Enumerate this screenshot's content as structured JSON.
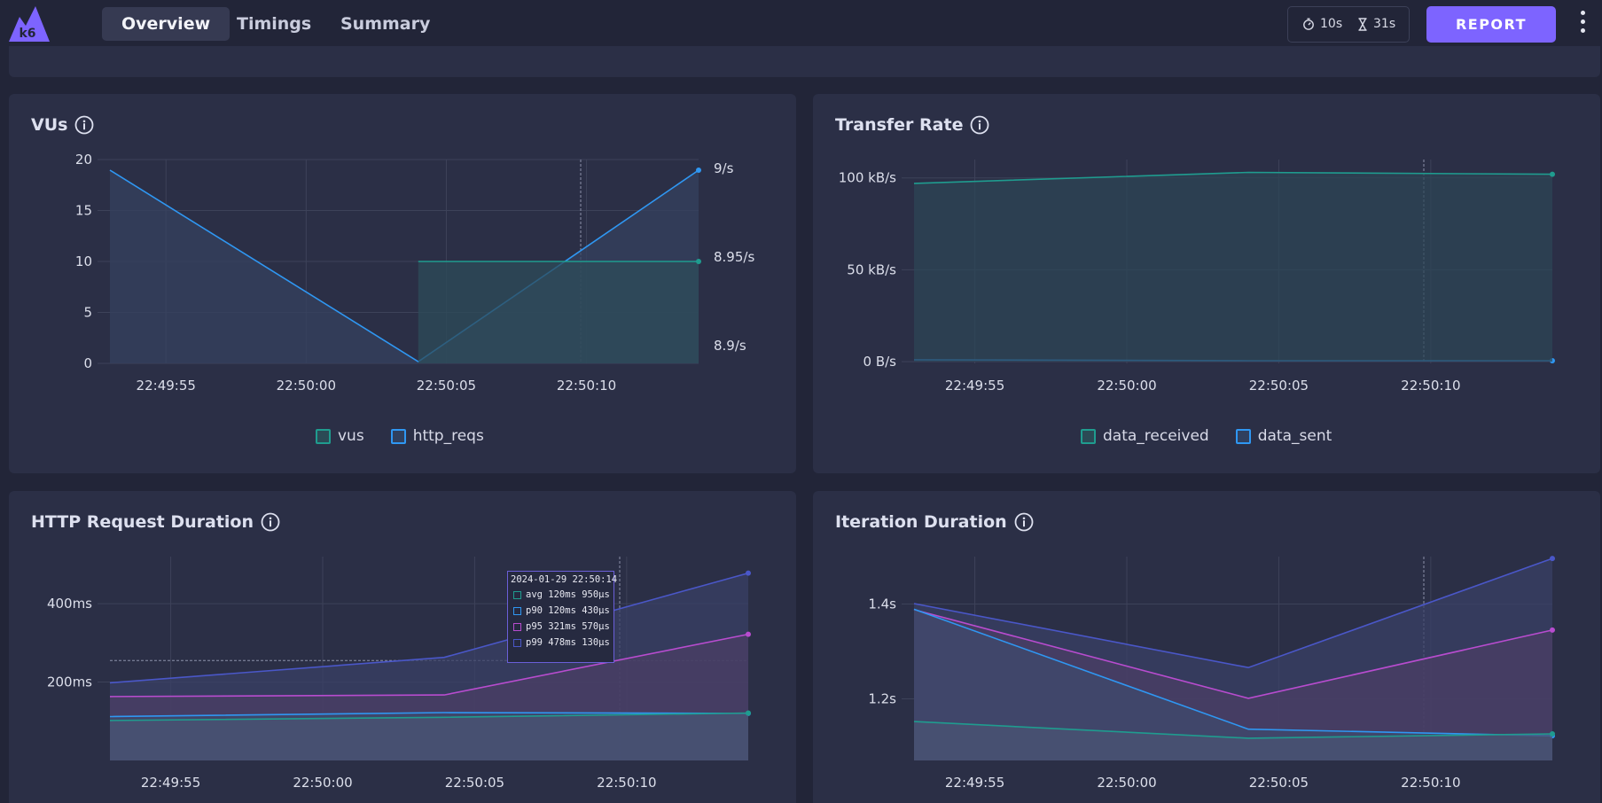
{
  "app": {
    "logo_text": "k6"
  },
  "nav": {
    "tabs": [
      {
        "label": "Overview",
        "active": true
      },
      {
        "label": "Timings",
        "active": false
      },
      {
        "label": "Summary",
        "active": false
      }
    ]
  },
  "header": {
    "period_label": "10s",
    "duration_label": "31s",
    "report_label": "REPORT",
    "period_icon": "stopwatch-icon",
    "duration_icon": "hourglass-icon"
  },
  "colors": {
    "accent": "#7d64ff",
    "teal": "#1f9c8f",
    "blue": "#2f97f2",
    "magenta": "#b84ccf",
    "indigo": "#4a57c8"
  },
  "panels": {
    "vus": {
      "title": "VUs",
      "legend": [
        "vus",
        "http_reqs"
      ]
    },
    "transfer": {
      "title": "Transfer Rate",
      "legend": [
        "data_received",
        "data_sent"
      ]
    },
    "http_duration": {
      "title": "HTTP Request Duration"
    },
    "iteration_duration": {
      "title": "Iteration Duration"
    }
  },
  "tooltip": {
    "title": "2024-01-29 22:50:14",
    "rows": [
      {
        "label": "avg 120ms 950µs",
        "color": "#1f9c8f"
      },
      {
        "label": "p90 120ms 430µs",
        "color": "#2f97f2"
      },
      {
        "label": "p95 321ms 570µs",
        "color": "#b84ccf"
      },
      {
        "label": "p99 478ms 130µs",
        "color": "#4a57c8"
      }
    ]
  },
  "chart_data": [
    {
      "id": "vus",
      "type": "area",
      "title": "VUs",
      "x": [
        "22:49:53",
        "22:50:04",
        "22:50:14"
      ],
      "x_ticks": [
        "22:49:55",
        "22:50:00",
        "22:50:05",
        "22:50:10"
      ],
      "y_left_ticks": [
        "0",
        "5",
        "10",
        "15",
        "20"
      ],
      "y_right_ticks": [
        "8.9/s",
        "8.95/s",
        "9/s"
      ],
      "ylim_left": [
        0,
        20
      ],
      "ylim_right": [
        8.89,
        9.005
      ],
      "series": [
        {
          "name": "vus",
          "axis": "left",
          "values": [
            null,
            10,
            10
          ]
        },
        {
          "name": "http_reqs",
          "axis": "right",
          "values": [
            8.999,
            8.891,
            8.999
          ]
        }
      ]
    },
    {
      "id": "transfer",
      "type": "area",
      "title": "Transfer Rate",
      "x": [
        "22:49:53",
        "22:50:04",
        "22:50:14"
      ],
      "x_ticks": [
        "22:49:55",
        "22:50:00",
        "22:50:05",
        "22:50:10"
      ],
      "y_ticks": [
        "0 B/s",
        "50 kB/s",
        "100 kB/s"
      ],
      "ylim": [
        0,
        110
      ],
      "y_unit": "kB/s",
      "series": [
        {
          "name": "data_received",
          "values": [
            97,
            103,
            102
          ]
        },
        {
          "name": "data_sent",
          "values": [
            1,
            0.5,
            0.5
          ]
        }
      ]
    },
    {
      "id": "http_duration",
      "type": "area",
      "title": "HTTP Request Duration",
      "x": [
        "22:49:53",
        "22:50:04",
        "22:50:14"
      ],
      "x_ticks": [
        "22:49:55",
        "22:50:00",
        "22:50:05",
        "22:50:10"
      ],
      "y_ticks": [
        "200ms",
        "400ms"
      ],
      "ylim": [
        0,
        520
      ],
      "series": [
        {
          "name": "avg",
          "values": [
            102,
            110,
            121
          ]
        },
        {
          "name": "p90",
          "values": [
            112,
            122,
            120
          ]
        },
        {
          "name": "p95",
          "values": [
            163,
            167,
            322
          ]
        },
        {
          "name": "p99",
          "values": [
            198,
            263,
            478
          ]
        }
      ]
    },
    {
      "id": "iteration_duration",
      "type": "area",
      "title": "Iteration Duration",
      "x": [
        "22:49:53",
        "22:50:04",
        "22:50:14"
      ],
      "x_ticks": [
        "22:49:55",
        "22:50:00",
        "22:50:05",
        "22:50:10"
      ],
      "y_ticks": [
        "1.2s",
        "1.4s"
      ],
      "ylim": [
        1.07,
        1.5
      ],
      "series": [
        {
          "name": "avg",
          "values": [
            1.152,
            1.117,
            1.126
          ]
        },
        {
          "name": "p90",
          "values": [
            1.389,
            1.136,
            1.122
          ]
        },
        {
          "name": "p95",
          "values": [
            1.388,
            1.201,
            1.345
          ]
        },
        {
          "name": "p99",
          "values": [
            1.401,
            1.266,
            1.496
          ]
        }
      ]
    }
  ]
}
